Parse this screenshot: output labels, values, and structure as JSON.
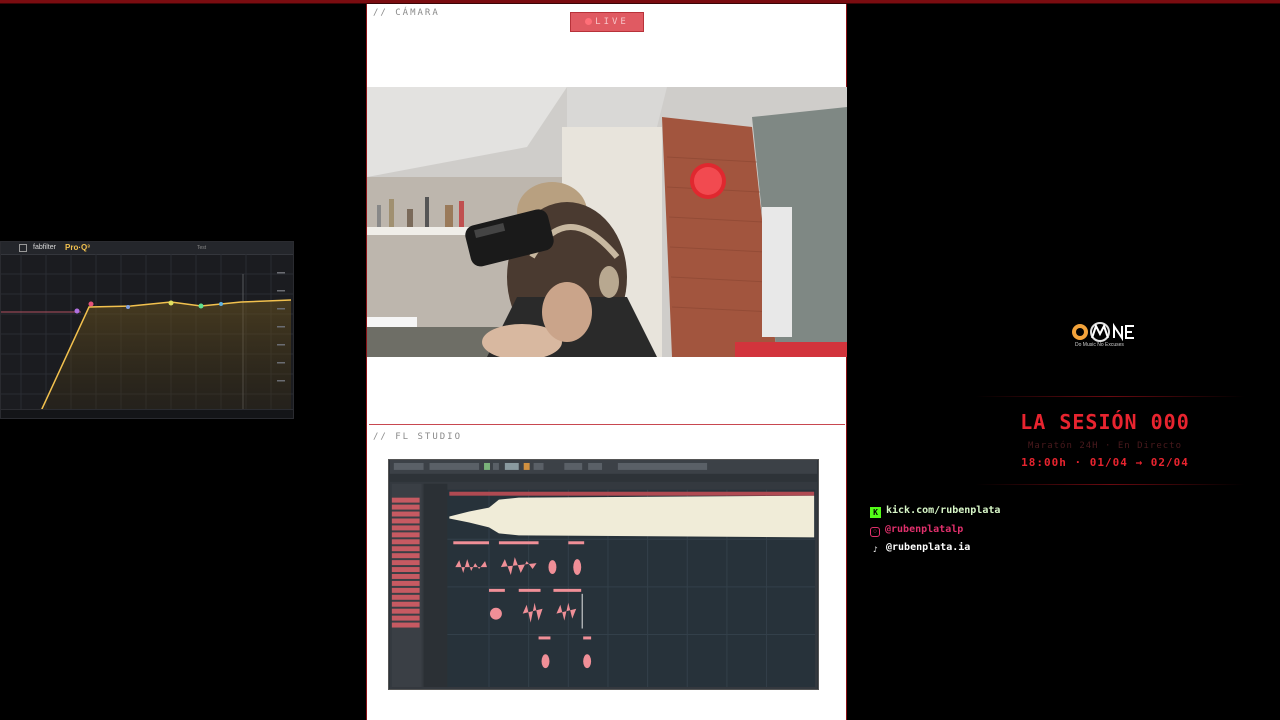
{
  "eq_plugin": {
    "brand": "fabfilter",
    "product": "Pro·Q³",
    "preset": "Test"
  },
  "overlay": {
    "camera_label": "// CÁMARA",
    "live_label": "LIVE",
    "fl_label": "// FL STUDIO"
  },
  "brand": {
    "logo_text": "Do Music No Excuses"
  },
  "session": {
    "title": "LA SESIÓN 000",
    "subtitle": "Maratón 24H · En Directo",
    "dates": "18:00h · 01/04 → 02/04"
  },
  "socials": [
    {
      "icon": "kick-icon",
      "label": "kick.com/rubenplata",
      "color": "#53fc18"
    },
    {
      "icon": "instagram-icon",
      "label": "@rubenplatalp",
      "color": "#e1306c"
    },
    {
      "icon": "tiktok-icon",
      "label": "@rubenplata.ia",
      "color": "#ffffff"
    }
  ],
  "colors": {
    "accent": "#e8242f",
    "live_bg": "#e05a62",
    "eq_curve": "#f2c14e"
  }
}
